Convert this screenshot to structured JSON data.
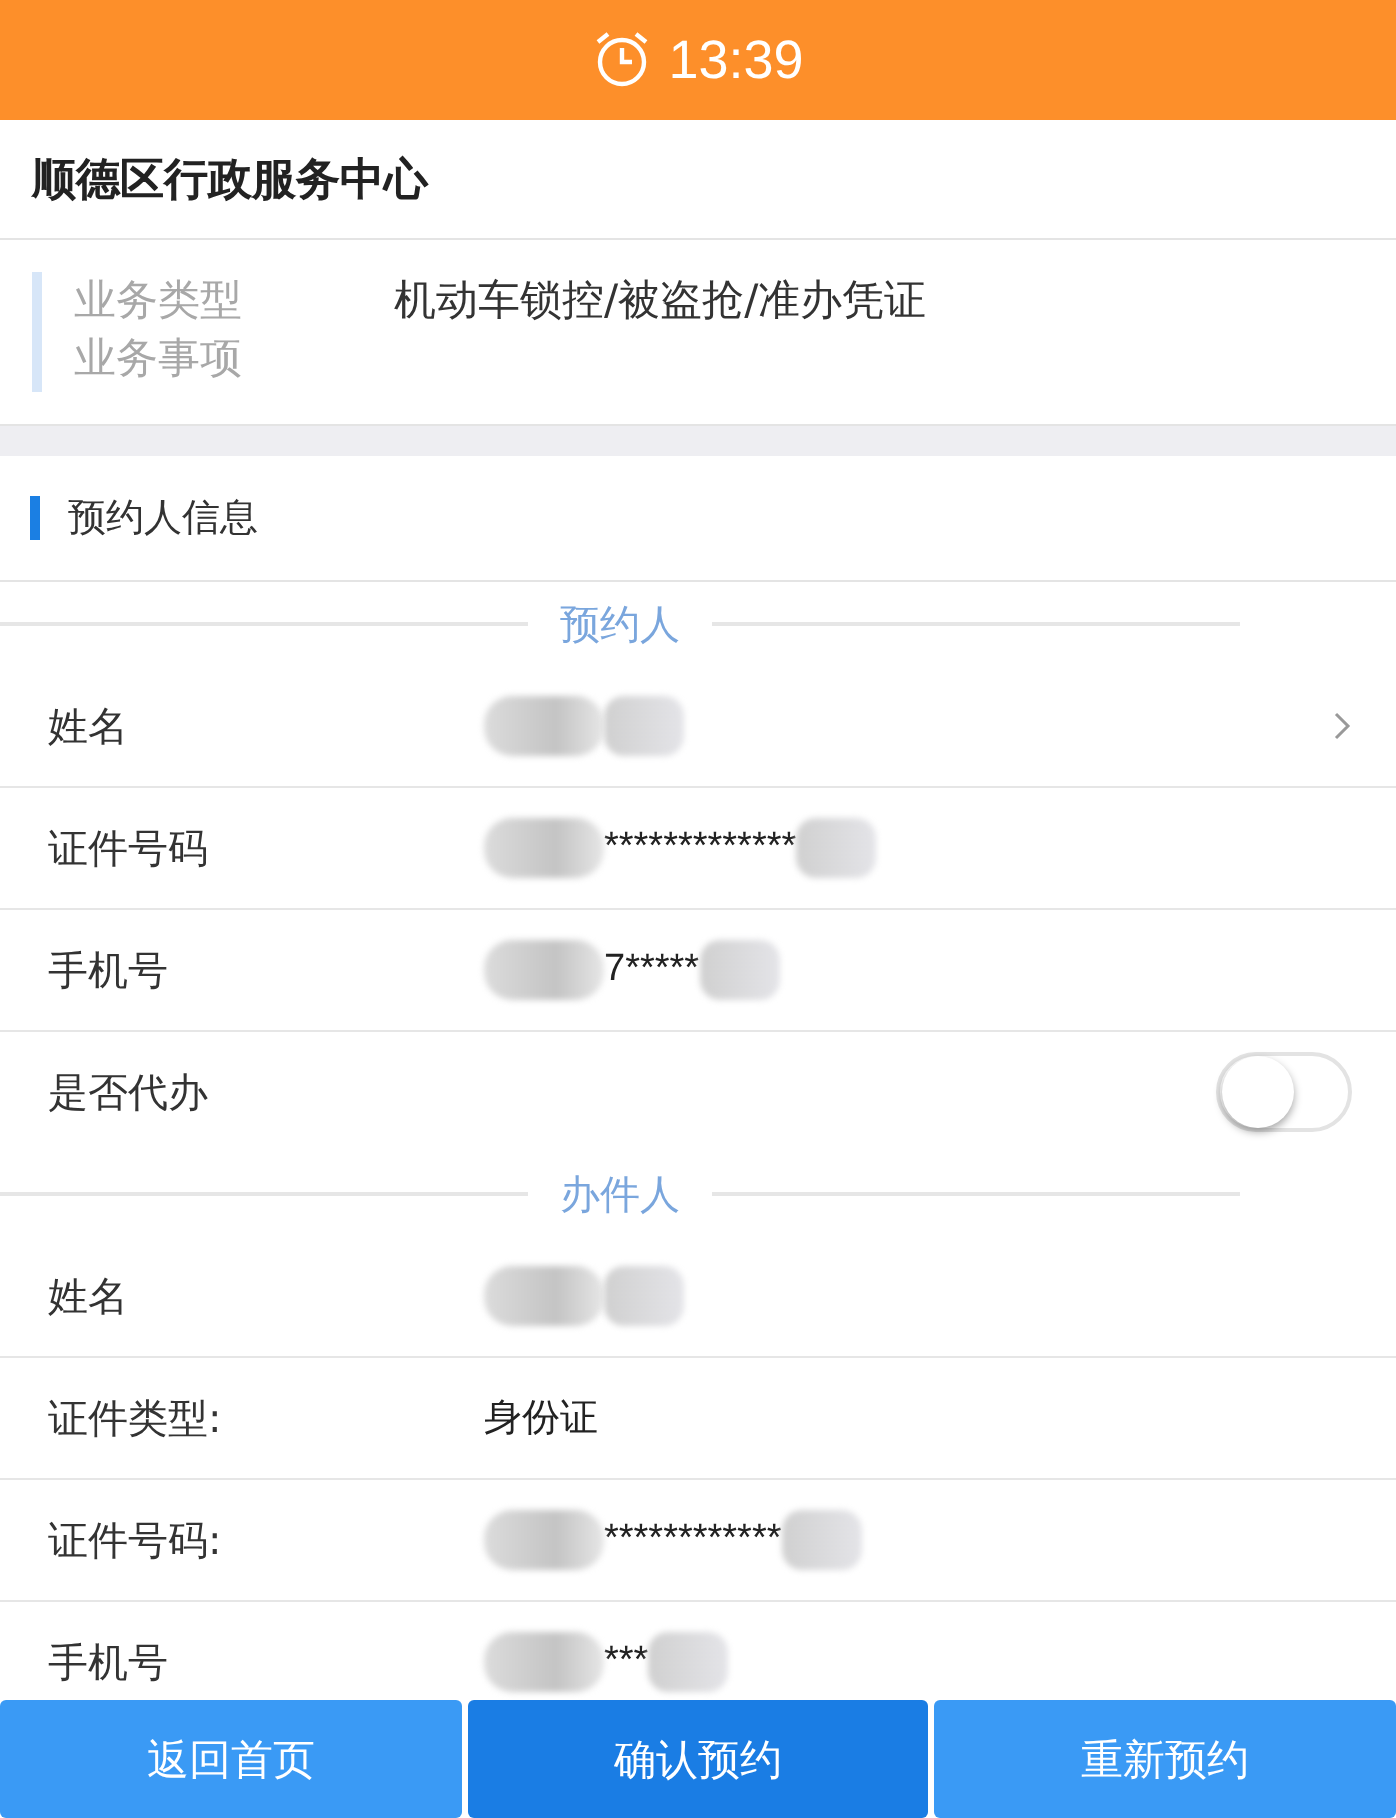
{
  "status_bar": {
    "time": "13:39"
  },
  "header": {
    "title": "顺德区行政服务中心"
  },
  "business": {
    "labels": [
      "业务类型",
      "业务事项"
    ],
    "value": "机动车锁控/被盗抢/准办凭证"
  },
  "section": {
    "title": "预约人信息"
  },
  "groups": [
    {
      "title": "预约人",
      "rows": [
        {
          "kind": "text",
          "label": "姓名",
          "redacted": true,
          "chevron": true
        },
        {
          "kind": "text",
          "label": "证件号码",
          "value": "*************",
          "redacted": true,
          "chevron": false
        },
        {
          "kind": "text",
          "label": "手机号",
          "value": "7*****",
          "redacted": true,
          "chevron": false
        },
        {
          "kind": "toggle",
          "label": "是否代办",
          "on": false
        }
      ]
    },
    {
      "title": "办件人",
      "rows": [
        {
          "kind": "text",
          "label": "姓名",
          "redacted": true,
          "chevron": false
        },
        {
          "kind": "text",
          "label": "证件类型:",
          "value": "身份证",
          "redacted": false,
          "chevron": false
        },
        {
          "kind": "text",
          "label": "证件号码:",
          "value": "************",
          "redacted": true,
          "chevron": false
        },
        {
          "kind": "text",
          "label": "手机号",
          "value": "***",
          "redacted": true,
          "chevron": false
        }
      ]
    }
  ],
  "buttons": [
    {
      "label": "返回首页",
      "selected": false
    },
    {
      "label": "确认预约",
      "selected": true
    },
    {
      "label": "重新预约",
      "selected": false
    }
  ]
}
